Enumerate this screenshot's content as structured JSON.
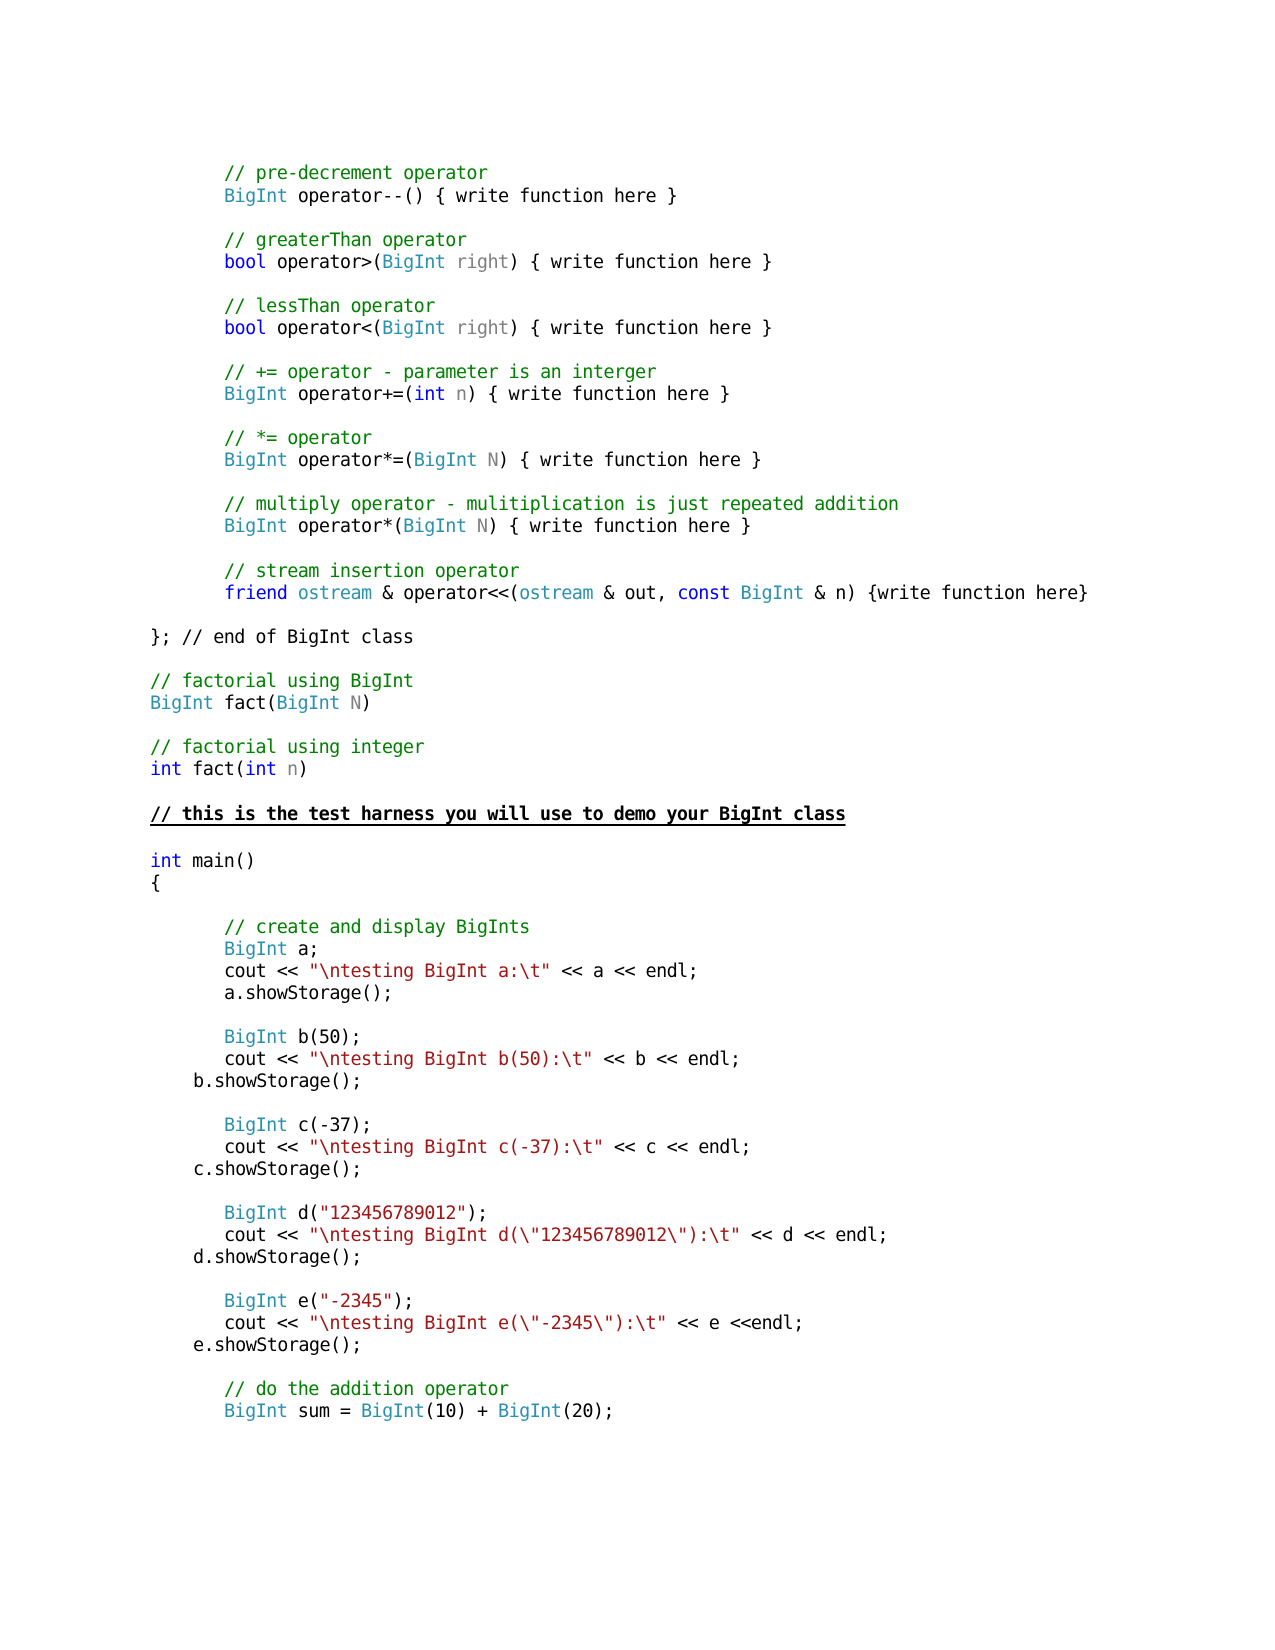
{
  "document": {
    "lines": [
      {
        "id": "l1",
        "tokens": [
          {
            "t": "// pre-decrement operator",
            "c": "comment"
          }
        ]
      },
      {
        "id": "l2",
        "tokens": [
          {
            "t": "BigInt",
            "c": "type"
          },
          {
            "t": " operator--() { write function here }",
            "c": "plain"
          }
        ]
      },
      {
        "id": "l3",
        "tokens": [
          {
            "t": "// greaterThan operator",
            "c": "comment"
          }
        ]
      },
      {
        "id": "l4",
        "tokens": [
          {
            "t": "bool",
            "c": "kw"
          },
          {
            "t": " operator>(",
            "c": "plain"
          },
          {
            "t": "BigInt",
            "c": "type"
          },
          {
            "t": " right",
            "c": "param"
          },
          {
            "t": ") { write function here }",
            "c": "plain"
          }
        ]
      },
      {
        "id": "l5",
        "tokens": [
          {
            "t": "// lessThan operator",
            "c": "comment"
          }
        ]
      },
      {
        "id": "l6",
        "tokens": [
          {
            "t": "bool",
            "c": "kw"
          },
          {
            "t": " operator<(",
            "c": "plain"
          },
          {
            "t": "BigInt",
            "c": "type"
          },
          {
            "t": " right",
            "c": "param"
          },
          {
            "t": ") { write function here }",
            "c": "plain"
          }
        ]
      },
      {
        "id": "l7",
        "tokens": [
          {
            "t": "// += operator - parameter is an interger",
            "c": "comment"
          }
        ]
      },
      {
        "id": "l8",
        "tokens": [
          {
            "t": "BigInt",
            "c": "type"
          },
          {
            "t": " operator+=(",
            "c": "plain"
          },
          {
            "t": "int",
            "c": "kw"
          },
          {
            "t": " n",
            "c": "param"
          },
          {
            "t": ") { write function here }",
            "c": "plain"
          }
        ]
      },
      {
        "id": "l9",
        "tokens": [
          {
            "t": "// *= operator",
            "c": "comment"
          }
        ]
      },
      {
        "id": "l10",
        "tokens": [
          {
            "t": "BigInt",
            "c": "type"
          },
          {
            "t": " operator*=(",
            "c": "plain"
          },
          {
            "t": "BigInt",
            "c": "type"
          },
          {
            "t": " N",
            "c": "param"
          },
          {
            "t": ") { write function here }",
            "c": "plain"
          }
        ]
      },
      {
        "id": "l11",
        "tokens": [
          {
            "t": "// multiply operator - mulitiplication is just repeated addition",
            "c": "comment"
          }
        ]
      },
      {
        "id": "l12",
        "tokens": [
          {
            "t": "BigInt",
            "c": "type"
          },
          {
            "t": " operator*(",
            "c": "plain"
          },
          {
            "t": "BigInt",
            "c": "type"
          },
          {
            "t": " N",
            "c": "param"
          },
          {
            "t": ") { write function here }",
            "c": "plain"
          }
        ]
      },
      {
        "id": "l13",
        "tokens": [
          {
            "t": "// stream insertion operator",
            "c": "comment"
          }
        ]
      },
      {
        "id": "l14",
        "tokens": [
          {
            "t": "friend",
            "c": "kw"
          },
          {
            "t": " ",
            "c": "plain"
          },
          {
            "t": "ostream",
            "c": "type"
          },
          {
            "t": " & operator<<(",
            "c": "plain"
          },
          {
            "t": "ostream",
            "c": "type"
          },
          {
            "t": " & out, ",
            "c": "plain"
          },
          {
            "t": "const",
            "c": "kw"
          },
          {
            "t": " ",
            "c": "plain"
          },
          {
            "t": "BigInt",
            "c": "type"
          },
          {
            "t": " & n) {write function here}",
            "c": "plain"
          }
        ]
      },
      {
        "id": "l15",
        "tokens": [
          {
            "t": "}; // end of BigInt class",
            "c": "plain"
          }
        ]
      },
      {
        "id": "l16",
        "tokens": [
          {
            "t": "// factorial using BigInt",
            "c": "comment"
          }
        ]
      },
      {
        "id": "l17",
        "tokens": [
          {
            "t": "BigInt",
            "c": "type"
          },
          {
            "t": " fact(",
            "c": "plain"
          },
          {
            "t": "BigInt",
            "c": "type"
          },
          {
            "t": " N",
            "c": "param"
          },
          {
            "t": ")",
            "c": "plain"
          }
        ]
      },
      {
        "id": "l18",
        "tokens": [
          {
            "t": "// factorial using integer",
            "c": "comment"
          }
        ]
      },
      {
        "id": "l19",
        "tokens": [
          {
            "t": "int",
            "c": "kw"
          },
          {
            "t": " fact(",
            "c": "plain"
          },
          {
            "t": "int",
            "c": "kw"
          },
          {
            "t": " n",
            "c": "param"
          },
          {
            "t": ")",
            "c": "plain"
          }
        ]
      },
      {
        "id": "l20",
        "heading": true,
        "tokens": [
          {
            "t": "// this is the test harness you will use to demo your BigInt class",
            "c": "plain"
          }
        ]
      },
      {
        "id": "l21",
        "tokens": [
          {
            "t": "int",
            "c": "kw"
          },
          {
            "t": " main()",
            "c": "plain"
          }
        ]
      },
      {
        "id": "l22",
        "tokens": [
          {
            "t": "{",
            "c": "plain"
          }
        ]
      },
      {
        "id": "l23",
        "tokens": [
          {
            "t": "// create and display BigInts",
            "c": "comment"
          }
        ]
      },
      {
        "id": "l24",
        "tokens": [
          {
            "t": "BigInt",
            "c": "type"
          },
          {
            "t": " a;",
            "c": "plain"
          }
        ]
      },
      {
        "id": "l25",
        "tokens": [
          {
            "t": "cout << ",
            "c": "plain"
          },
          {
            "t": "\"\\ntesting BigInt a:\\t\"",
            "c": "str"
          },
          {
            "t": " << a << endl;",
            "c": "plain"
          }
        ]
      },
      {
        "id": "l26",
        "tokens": [
          {
            "t": "a.showStorage();",
            "c": "plain"
          }
        ]
      },
      {
        "id": "l27",
        "tokens": [
          {
            "t": "BigInt",
            "c": "type"
          },
          {
            "t": " b(50);",
            "c": "plain"
          }
        ]
      },
      {
        "id": "l28",
        "tokens": [
          {
            "t": "cout << ",
            "c": "plain"
          },
          {
            "t": "\"\\ntesting BigInt b(50):\\t\"",
            "c": "str"
          },
          {
            "t": " << b << endl;",
            "c": "plain"
          }
        ]
      },
      {
        "id": "l29",
        "tokens": [
          {
            "t": "b.showStorage();",
            "c": "plain"
          }
        ]
      },
      {
        "id": "l30",
        "tokens": [
          {
            "t": "BigInt",
            "c": "type"
          },
          {
            "t": " c(-37);",
            "c": "plain"
          }
        ]
      },
      {
        "id": "l31",
        "tokens": [
          {
            "t": "cout << ",
            "c": "plain"
          },
          {
            "t": "\"\\ntesting BigInt c(-37):\\t\"",
            "c": "str"
          },
          {
            "t": " << c << endl;",
            "c": "plain"
          }
        ]
      },
      {
        "id": "l32",
        "tokens": [
          {
            "t": "c.showStorage();",
            "c": "plain"
          }
        ]
      },
      {
        "id": "l33",
        "tokens": [
          {
            "t": "BigInt",
            "c": "type"
          },
          {
            "t": " d(",
            "c": "plain"
          },
          {
            "t": "\"123456789012\"",
            "c": "str"
          },
          {
            "t": ");",
            "c": "plain"
          }
        ]
      },
      {
        "id": "l34",
        "tokens": [
          {
            "t": "cout << ",
            "c": "plain"
          },
          {
            "t": "\"\\ntesting BigInt d(\\\"123456789012\\\"):\\t\"",
            "c": "str"
          },
          {
            "t": " << d << endl;",
            "c": "plain"
          }
        ]
      },
      {
        "id": "l35",
        "tokens": [
          {
            "t": "d.showStorage();",
            "c": "plain"
          }
        ]
      },
      {
        "id": "l36",
        "tokens": [
          {
            "t": "BigInt",
            "c": "type"
          },
          {
            "t": " e(",
            "c": "plain"
          },
          {
            "t": "\"-2345\"",
            "c": "str"
          },
          {
            "t": ");",
            "c": "plain"
          }
        ]
      },
      {
        "id": "l37",
        "tokens": [
          {
            "t": "cout << ",
            "c": "plain"
          },
          {
            "t": "\"\\ntesting BigInt e(\\\"-2345\\\"):\\t\"",
            "c": "str"
          },
          {
            "t": " << e <<endl;",
            "c": "plain"
          }
        ]
      },
      {
        "id": "l38",
        "tokens": [
          {
            "t": "e.showStorage();",
            "c": "plain"
          }
        ]
      },
      {
        "id": "l39",
        "tokens": [
          {
            "t": "// do the addition operator",
            "c": "comment"
          }
        ]
      },
      {
        "id": "l40",
        "tokens": [
          {
            "t": "BigInt",
            "c": "type"
          },
          {
            "t": " sum = ",
            "c": "plain"
          },
          {
            "t": "BigInt",
            "c": "type"
          },
          {
            "t": "(10) + ",
            "c": "plain"
          },
          {
            "t": "BigInt",
            "c": "type"
          },
          {
            "t": "(20);",
            "c": "plain"
          }
        ]
      }
    ],
    "colors": {
      "comment": "#008000",
      "type": "#2b91af",
      "keyword": "#0000ff",
      "param": "#808080",
      "string": "#a31515",
      "plain": "#000000"
    }
  }
}
